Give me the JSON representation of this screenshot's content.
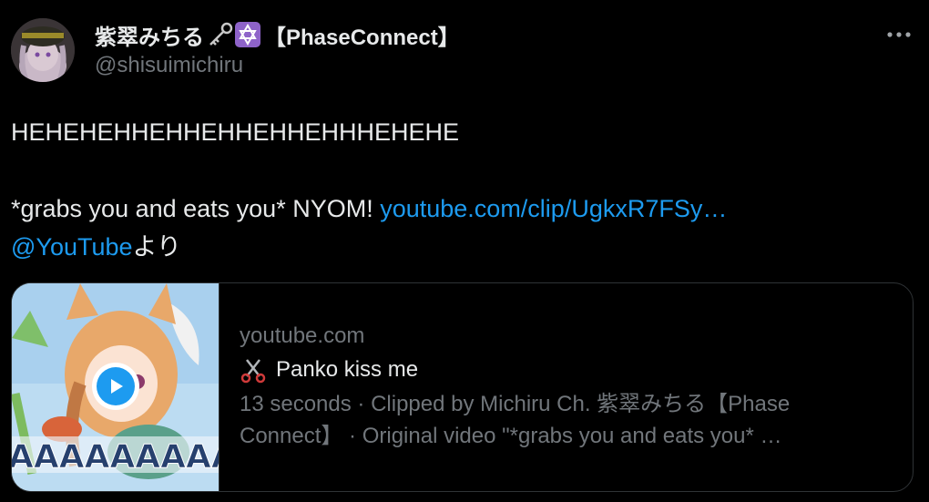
{
  "author": {
    "display_name": "紫翠みちる",
    "emoji_1": "key-icon",
    "emoji_2": "star-of-david-icon",
    "affiliation": "【PhaseConnect】",
    "handle": "@shisuimichiru"
  },
  "tweet": {
    "line1": "HEHEHEHHEHHEHHEHHEHHHEHEHE",
    "line2_text": "*grabs you and eats you* NYOM! ",
    "line2_link": "youtube.com/clip/UgkxR7FSy…",
    "line3_mention": "@YouTube",
    "line3_suffix": "より"
  },
  "card": {
    "domain": "youtube.com",
    "title": "Panko kiss me",
    "title_icon": "scissors-icon",
    "description": "13 seconds · Clipped by Michiru Ch. 紫翠みちる【Phase Connect】 · Original video \"*grabs you and eats you* …",
    "thumbnail_text": "AAAAAAAAA"
  },
  "colors": {
    "background": "#000000",
    "text": "#e7e9ea",
    "muted": "#71767b",
    "link": "#1d9bf0",
    "border": "#2f3336"
  }
}
